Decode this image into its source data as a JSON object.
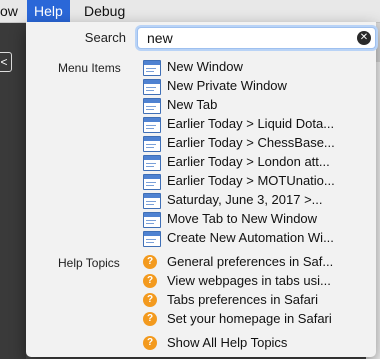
{
  "menubar": {
    "items": [
      "ow",
      "Help",
      "Debug"
    ]
  },
  "left_button": "<",
  "search": {
    "label": "Search",
    "value": "new",
    "clear_icon": "clear-circle-icon"
  },
  "sections": {
    "menu_items_label": "Menu Items",
    "help_topics_label": "Help Topics"
  },
  "menu_items": [
    "New Window",
    "New Private Window",
    "New Tab",
    "Earlier Today > Liquid Dota...",
    "Earlier Today > ChessBase...",
    "Earlier Today > London att...",
    "Earlier Today > MOTUnatio...",
    "Saturday, June 3, 2017 >...",
    "Move Tab to New Window",
    "Create New Automation Wi..."
  ],
  "help_topics": [
    "General preferences in Saf...",
    "View webpages in tabs usi...",
    "Tabs preferences in Safari",
    "Set your homepage in Safari"
  ],
  "show_all": "Show All Help Topics",
  "colors": {
    "menubar_active": "#2a67d8",
    "help_icon": "#f39a1e",
    "window_icon": "#4f82d1"
  }
}
